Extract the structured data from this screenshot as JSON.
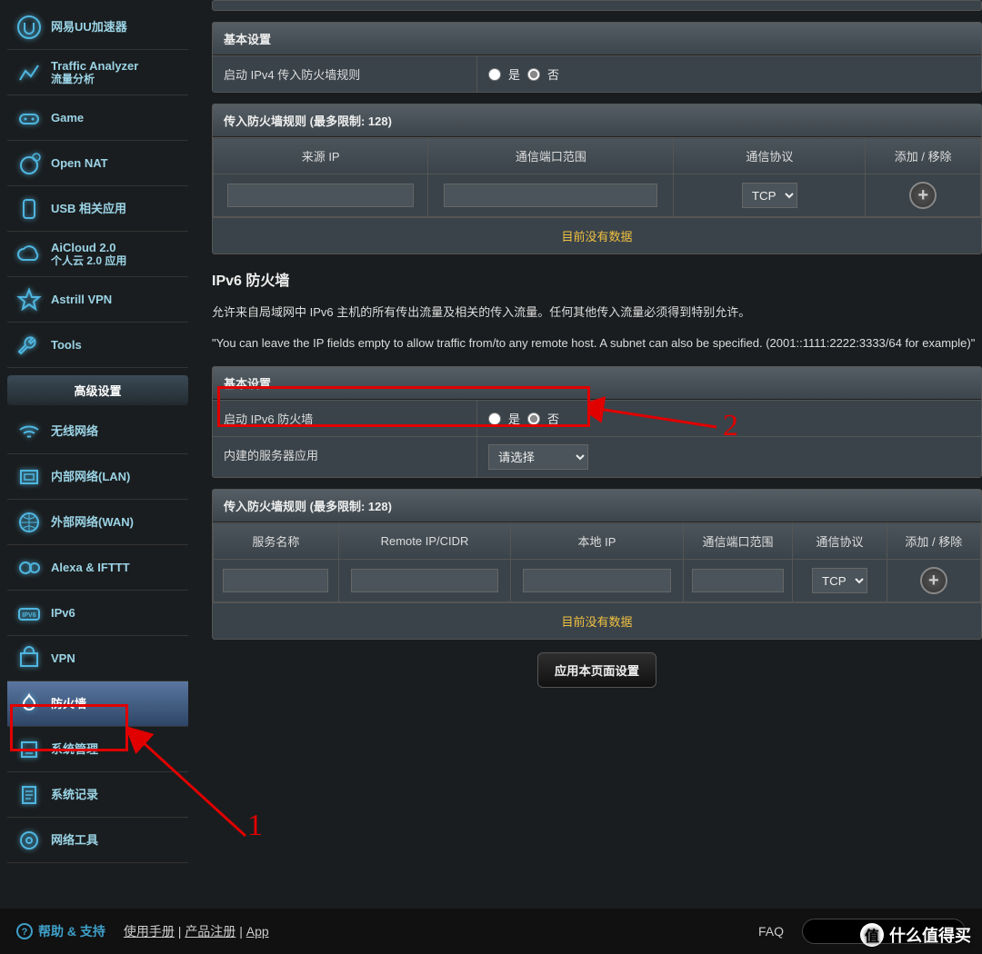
{
  "sidebar": {
    "items": [
      {
        "label": "网易UU加速器"
      },
      {
        "label": "Traffic Analyzer",
        "sub": "流量分析"
      },
      {
        "label": "Game"
      },
      {
        "label": "Open NAT"
      },
      {
        "label": "USB 相关应用"
      },
      {
        "label": "AiCloud 2.0",
        "sub": "个人云 2.0 应用"
      },
      {
        "label": "Astrill VPN"
      },
      {
        "label": "Tools"
      }
    ],
    "advanced_header": "高级设置",
    "adv_items": [
      {
        "label": "无线网络"
      },
      {
        "label": "内部网络(LAN)"
      },
      {
        "label": "外部网络(WAN)"
      },
      {
        "label": "Alexa & IFTTT"
      },
      {
        "label": "IPv6"
      },
      {
        "label": "VPN"
      },
      {
        "label": "防火墙",
        "active": true
      },
      {
        "label": "系统管理"
      },
      {
        "label": "系统记录"
      },
      {
        "label": "网络工具"
      }
    ]
  },
  "ipv4": {
    "basic_header": "基本设置",
    "enable_label": "启动 IPv4 传入防火墙规则",
    "yes": "是",
    "no": "否",
    "rules_header": "传入防火墙规则 (最多限制: 128)",
    "cols": {
      "src": "来源 IP",
      "port": "通信端口范围",
      "proto": "通信协议",
      "action": "添加 / 移除"
    },
    "proto_default": "TCP",
    "no_data": "目前没有数据"
  },
  "ipv6": {
    "title": "IPv6 防火墙",
    "desc1": "允许来自局域网中 IPv6 主机的所有传出流量及相关的传入流量。任何其他传入流量必须得到特别允许。",
    "desc2": "\"You can leave the IP fields empty to allow traffic from/to any remote host. A subnet can also be specified. (2001::1111:2222:3333/64 for example)\"",
    "basic_header": "基本设置",
    "enable_label": "启动 IPv6 防火墙",
    "yes": "是",
    "no": "否",
    "server_label": "内建的服务器应用",
    "server_placeholder": "请选择",
    "rules_header": "传入防火墙规则 (最多限制: 128)",
    "cols": {
      "service": "服务名称",
      "remote": "Remote IP/CIDR",
      "local": "本地 IP",
      "port": "通信端口范围",
      "proto": "通信协议",
      "action": "添加 / 移除"
    },
    "proto_default": "TCP",
    "no_data": "目前没有数据"
  },
  "apply_btn": "应用本页面设置",
  "footer": {
    "help": "帮助 & 支持",
    "manual": "使用手册",
    "register": "产品注册",
    "app": "App",
    "faq": "FAQ"
  },
  "watermark": "什么值得买",
  "watermark_badge": "值",
  "annotations": {
    "n1": "1",
    "n2": "2"
  }
}
